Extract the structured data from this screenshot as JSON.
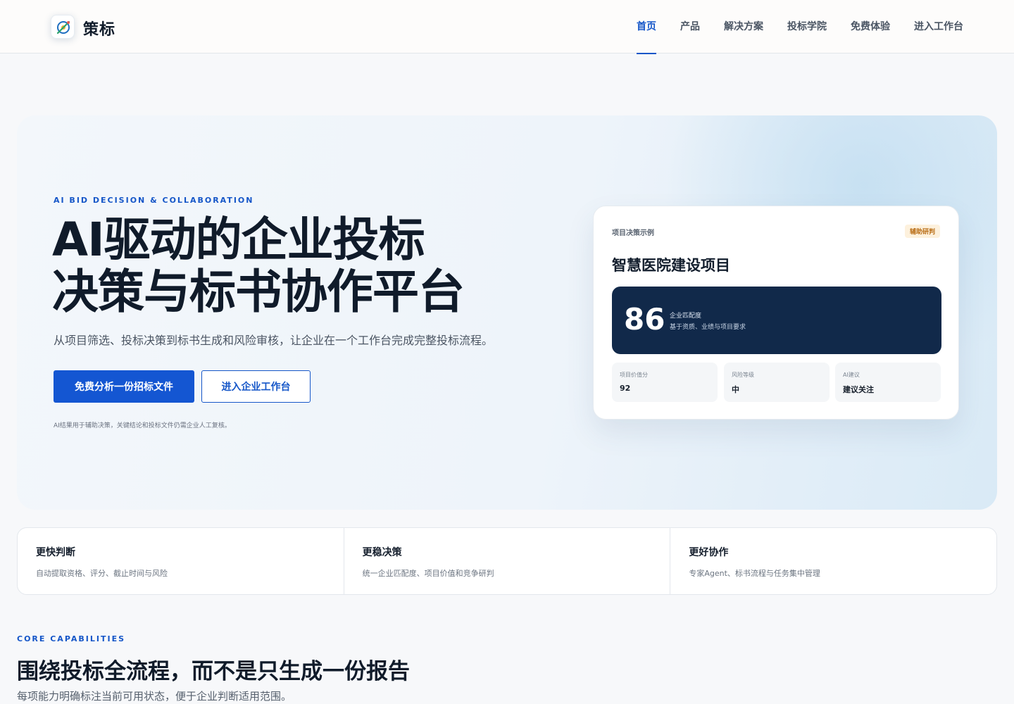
{
  "header": {
    "brand": "策标",
    "logo_icon": "target-compass-icon",
    "nav": [
      {
        "label": "首页",
        "active": true
      },
      {
        "label": "产品",
        "active": false
      },
      {
        "label": "解决方案",
        "active": false
      },
      {
        "label": "投标学院",
        "active": false
      },
      {
        "label": "免费体验",
        "active": false
      },
      {
        "label": "进入工作台",
        "active": false
      }
    ]
  },
  "hero": {
    "eyebrow": "AI BID DECISION & COLLABORATION",
    "title_line1": "AI驱动的企业投标",
    "title_line2": "决策与标书协作平台",
    "description": "从项目筛选、投标决策到标书生成和风险审核，让企业在一个工作台完成完整投标流程。",
    "primary_button": "免费分析一份招标文件",
    "secondary_button": "进入企业工作台",
    "note": "AI结果用于辅助决策，关键结论和投标文件仍需企业人工复核。"
  },
  "project_card": {
    "label": "项目决策示例",
    "badge": "辅助研判",
    "title": "智慧医院建设项目",
    "score": "86",
    "score_label": "企业匹配度",
    "score_sub": "基于资质、业绩与项目要求",
    "metrics": [
      {
        "label": "项目价值分",
        "value": "92"
      },
      {
        "label": "风险等级",
        "value": "中"
      },
      {
        "label": "AI建议",
        "value": "建议关注"
      }
    ]
  },
  "features": [
    {
      "title": "更快判断",
      "desc": "自动提取资格、评分、截止时间与风险"
    },
    {
      "title": "更稳决策",
      "desc": "统一企业匹配度、项目价值和竞争研判"
    },
    {
      "title": "更好协作",
      "desc": "专家Agent、标书流程与任务集中管理"
    }
  ],
  "core": {
    "eyebrow": "CORE CAPABILITIES",
    "title": "围绕投标全流程，而不是只生成一份报告",
    "desc": "每项能力明确标注当前可用状态，便于企业判断适用范围。"
  },
  "colors": {
    "accent": "#1556c8",
    "dark_panel": "#11294a",
    "badge_bg": "#fdf1dd",
    "badge_text": "#b86b12"
  }
}
